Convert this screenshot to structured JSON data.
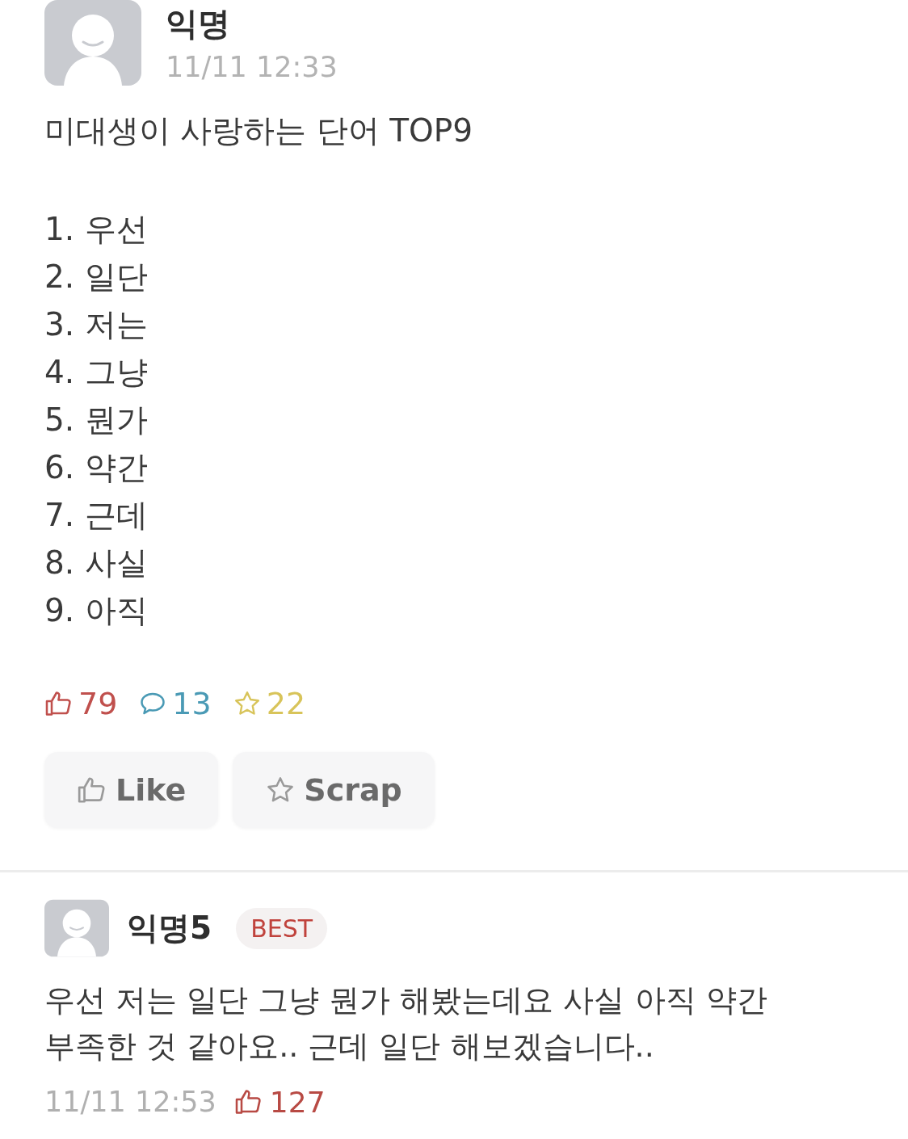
{
  "post": {
    "author": "익명",
    "time": "11/11 12:33",
    "title": "미대생이 사랑하는 단어 TOP9",
    "list": [
      "1. 우선",
      "2. 일단",
      "3. 저는",
      "4. 그냥",
      "5. 뭔가",
      "6. 약간",
      "7. 근데",
      "8. 사실",
      "9. 아직"
    ]
  },
  "stats": [
    {
      "kind": "like",
      "count": "79",
      "color": "#c0504d"
    },
    {
      "kind": "comment",
      "count": "13",
      "color": "#4a9ab5"
    },
    {
      "kind": "scrap",
      "count": "22",
      "color": "#d8c45a"
    }
  ],
  "buttons": [
    {
      "kind": "like",
      "label": "Like"
    },
    {
      "kind": "scrap",
      "label": "Scrap"
    }
  ],
  "comment": {
    "author": "익명5",
    "badge": "BEST",
    "text_lines": [
      "우선 저는 일단 그냥 뭔가 해봤는데요 사실 아직 약간",
      "부족한 것 같아요.. 근데 일단 해보겠습니다.."
    ],
    "time": "11/11 12:53",
    "likes": "127"
  }
}
